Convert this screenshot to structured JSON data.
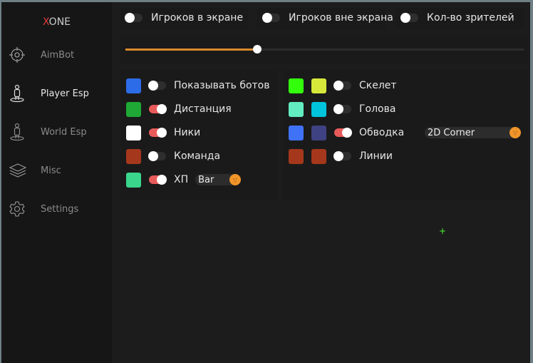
{
  "app": {
    "logo_x": "X",
    "logo_rest": "ONE"
  },
  "sidebar": {
    "items": [
      {
        "label": "AimBot",
        "icon": "crosshair-icon"
      },
      {
        "label": "Player Esp",
        "icon": "player-icon",
        "active": true
      },
      {
        "label": "World Esp",
        "icon": "player-icon"
      },
      {
        "label": "Misc",
        "icon": "layers-icon"
      },
      {
        "label": "Settings",
        "icon": "gear-icon"
      }
    ]
  },
  "top": {
    "toggles": [
      {
        "label": "Игроков в экране",
        "on": false
      },
      {
        "label": "Игроков вне экрана",
        "on": false
      },
      {
        "label": "Кол-во зрителей",
        "on": false
      }
    ],
    "slider": {
      "fraction": 0.33,
      "accent": "#d8892e"
    }
  },
  "left": {
    "rows": [
      {
        "color": "#2d6ce8",
        "label": "Показывать ботов",
        "on": false
      },
      {
        "color": "#1fa835",
        "label": "Дистанция",
        "on": true
      },
      {
        "color": "#ffffff",
        "label": "Ники",
        "on": true
      },
      {
        "color": "#a5381c",
        "label": "Команда",
        "on": false
      },
      {
        "color": "#39d68c",
        "label": "ХП",
        "on": true,
        "dropdown": "Bar"
      }
    ]
  },
  "right": {
    "rows": [
      {
        "color1": "#33ff0d",
        "color2": "#d7e83a",
        "label": "Скелет",
        "on": false
      },
      {
        "color1": "#62ecbf",
        "color2": "#00c4dc",
        "label": "Голова",
        "on": false
      },
      {
        "color1": "#3f72f6",
        "color2": "#3e4282",
        "label": "Обводка",
        "on": true,
        "dropdown": "2D Corner"
      },
      {
        "color1": "#a5381c",
        "color2": "#a5381c",
        "label": "Линии",
        "on": false
      }
    ]
  },
  "crosshair": "+"
}
